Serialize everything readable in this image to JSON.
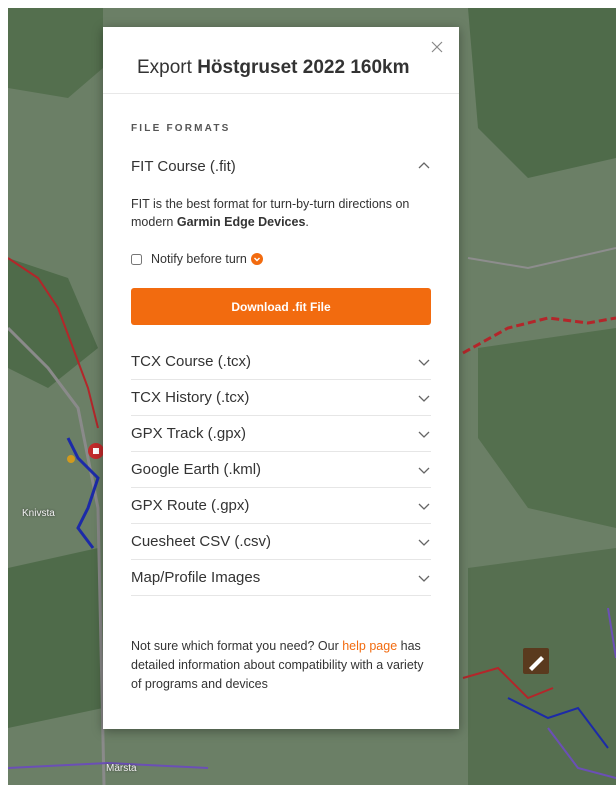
{
  "map": {
    "place_labels": [
      "Knivsta",
      "Märsta"
    ],
    "colors": {
      "land": "#6b7f66",
      "forest": "#4f6b4a",
      "route_red": "#b3262a",
      "route_blue": "#1c2aa8",
      "route_purple": "#6b4fb6"
    }
  },
  "modal": {
    "title_prefix": "Export",
    "title_route": "Höstgruset 2022 160km",
    "section_label": "FILE FORMATS",
    "expanded_format": {
      "label": "FIT Course (.fit)",
      "description_prefix": "FIT is the best format for turn-by-turn directions on modern",
      "description_bold": "Garmin Edge Devices",
      "description_suffix": ".",
      "notify_label": "Notify before turn",
      "notify_checked": false,
      "download_label": "Download .fit File"
    },
    "formats": [
      {
        "label": "TCX Course (.tcx)"
      },
      {
        "label": "TCX History (.tcx)"
      },
      {
        "label": "GPX Track (.gpx)"
      },
      {
        "label": "Google Earth (.kml)"
      },
      {
        "label": "GPX Route (.gpx)"
      },
      {
        "label": "Cuesheet CSV (.csv)"
      },
      {
        "label": "Map/Profile Images"
      }
    ],
    "footer": {
      "text_before": "Not sure which format you need? Our",
      "link": "help page",
      "text_after": "has detailed information about compatibility with a variety of programs and devices"
    },
    "accent_color": "#f26b0f"
  }
}
